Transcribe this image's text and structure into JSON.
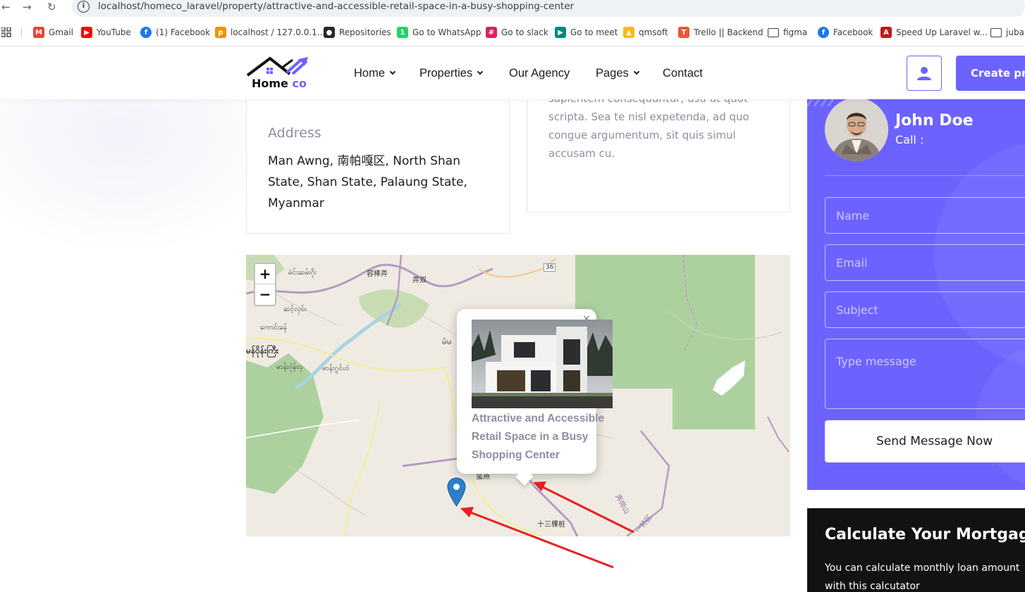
{
  "browser": {
    "url": "localhost/homeco_laravel/property/attractive-and-accessible-retail-space-in-a-busy-shopping-center",
    "bookmarks": [
      {
        "label": "Gmail",
        "icon": "gmail-icon",
        "color": "#ea4335",
        "glyph": "M"
      },
      {
        "label": "YouTube",
        "icon": "youtube-icon",
        "color": "#ff0000",
        "glyph": "▶"
      },
      {
        "label": "(1) Facebook",
        "icon": "facebook-icon",
        "color": "#1877f2",
        "glyph": "f"
      },
      {
        "label": "localhost / 127.0.0.1...",
        "icon": "phpmyadmin-icon",
        "color": "#f29111",
        "glyph": "p"
      },
      {
        "label": "Repositories",
        "icon": "github-icon",
        "color": "#24292e",
        "glyph": "●"
      },
      {
        "label": "Go to WhatsApp",
        "icon": "whatsapp-icon",
        "color": "#25d366",
        "glyph": "1"
      },
      {
        "label": "Go to slack",
        "icon": "slack-icon",
        "color": "#e01e5a",
        "glyph": "#"
      },
      {
        "label": "Go to meet",
        "icon": "meet-icon",
        "color": "#00897b",
        "glyph": "▶"
      },
      {
        "label": "qmsoft",
        "icon": "drive-icon",
        "color": "#fbbc04",
        "glyph": "▲"
      },
      {
        "label": "Trello || Backend",
        "icon": "trello-icon",
        "color": "#e8573c",
        "glyph": "T"
      },
      {
        "label": "figma",
        "icon": "folder-icon",
        "color": "#ffffff",
        "glyph": ""
      },
      {
        "label": "Facebook",
        "icon": "facebook-icon",
        "color": "#1877f2",
        "glyph": "f"
      },
      {
        "label": "Speed Up Laravel w...",
        "icon": "laracasts-icon",
        "color": "#c4161c",
        "glyph": "A"
      },
      {
        "label": "jubai",
        "icon": "folder-icon",
        "color": "#ffffff",
        "glyph": ""
      }
    ]
  },
  "header": {
    "logo": {
      "word1": "Home",
      "word2": "co"
    },
    "menu": [
      {
        "label": "Home",
        "dropdown": true
      },
      {
        "label": "Properties",
        "dropdown": true
      },
      {
        "label": "Our Agency",
        "dropdown": false
      },
      {
        "label": "Pages",
        "dropdown": true
      },
      {
        "label": "Contact",
        "dropdown": false
      }
    ],
    "create_button": "Create pro"
  },
  "address_card": {
    "heading": "Address",
    "text": "Man Awng, 南帕嘎区, North Shan State, Shan State, Palaung State, Myanmar"
  },
  "description_card": {
    "text": "sapientem consequuntur, usu ut quot scripta. Sea te nisl expetenda, ad quo congue argumentum, sit quis simul accusam cu."
  },
  "map": {
    "zoom_in": "+",
    "zoom_out": "−",
    "popup_close": "×",
    "popup_title": "Attractive and Accessible Retail Space in a Busy Shopping Center",
    "labels": [
      {
        "text": "မံင်းဆမ်းဂိုး"
      },
      {
        "text": "容棒弄"
      },
      {
        "text": "弄双"
      },
      {
        "text": "36"
      },
      {
        "text": "ဆင့်လုပ်း"
      },
      {
        "text": "ကောင်းခန်"
      },
      {
        "text": "မန်ဝိုန်းကြီး"
      },
      {
        "text": "မာန်းဂုဲန်လှ"
      },
      {
        "text": "မာန်းဂွင်ဟဲ"
      },
      {
        "text": "မံမ"
      },
      {
        "text": "十三棵桩"
      },
      {
        "text": "蛮燕"
      },
      {
        "text": "一特区"
      },
      {
        "text": "弄岗山"
      }
    ]
  },
  "contact": {
    "agent_name": "John Doe",
    "call_label": "Call :",
    "name_placeholder": "Name",
    "email_placeholder": "Email",
    "subject_placeholder": "Subject",
    "message_placeholder": "Type message",
    "send_button": "Send Message Now"
  },
  "mortgage": {
    "title": "Calculate Your Mortgage",
    "text": "You can calculate monthly loan amount with this calcutator"
  },
  "colors": {
    "brand": "#6c63ff",
    "annotation": "#e8201f",
    "marker": "#2a81cb"
  }
}
